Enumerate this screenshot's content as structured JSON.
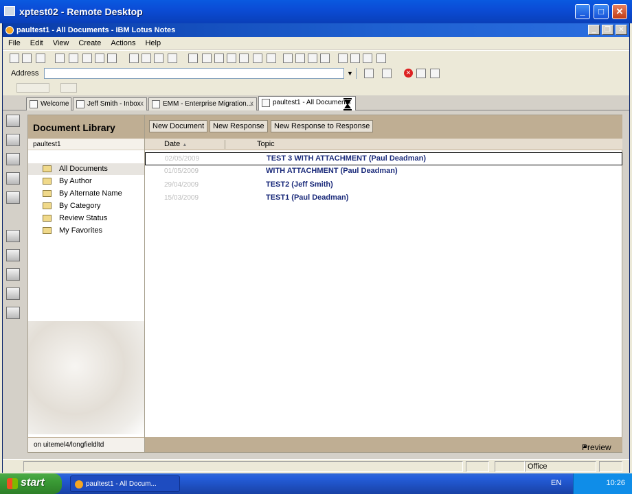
{
  "remote_desktop": {
    "title": "xptest02 - Remote Desktop",
    "buttons": {
      "minimize": "_",
      "maximize": "□",
      "close": "✕"
    }
  },
  "notes_window": {
    "title": "paultest1 - All Documents - IBM Lotus Notes",
    "buttons": {
      "minimize": "_",
      "restore": "❐",
      "close": "✕"
    }
  },
  "menu": [
    "File",
    "Edit",
    "View",
    "Create",
    "Actions",
    "Help"
  ],
  "address": {
    "label": "Address",
    "value": ""
  },
  "tabs": [
    {
      "label": "Welcome"
    },
    {
      "label": "Jeff Smith - Inbox"
    },
    {
      "label": "EMM - Enterprise Migration..."
    },
    {
      "label": "paultest1 - All Documents"
    }
  ],
  "nav": {
    "title": "Document Library",
    "db_name": "paultest1",
    "items": [
      {
        "label": "All Documents",
        "selected": true
      },
      {
        "label": "By Author"
      },
      {
        "label": "By Alternate Name"
      },
      {
        "label": "By Category"
      },
      {
        "label": "Review Status"
      },
      {
        "label": "My Favorites"
      }
    ],
    "footer": "on uitemel4/longfieldltd"
  },
  "actions": [
    "New Document",
    "New Response",
    "New Response to Response"
  ],
  "columns": {
    "date": "Date",
    "topic": "Topic",
    "sort_glyph": "▲"
  },
  "documents": [
    {
      "date": "02/05/2009",
      "topic": "TEST 3 WITH ATTACHMENT (Paul Deadman)"
    },
    {
      "date": "01/05/2009",
      "topic": "WITH ATTACHMENT (Paul Deadman)"
    },
    {
      "date": "29/04/2009",
      "topic": "TEST2 (Jeff Smith)"
    },
    {
      "date": "15/03/2009",
      "topic": "TEST1 (Paul Deadman)"
    }
  ],
  "preview": {
    "label": "Preview",
    "glyph": "▲"
  },
  "statusbar": {
    "location": "Office"
  },
  "taskbar": {
    "start": "start",
    "task": "paultest1 - All Docum...",
    "lang": "EN",
    "clock": "10:26"
  },
  "colors": {
    "accent": "#bfae93",
    "xp_blue": "#0a5ae0",
    "topic_text": "#1a2a7a"
  }
}
